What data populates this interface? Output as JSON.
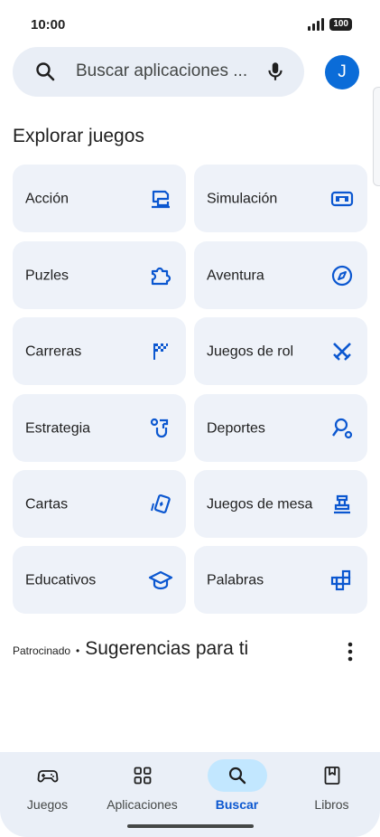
{
  "status_bar": {
    "time": "10:00",
    "battery": "100"
  },
  "search": {
    "placeholder": "Buscar aplicaciones ...",
    "icon": "search-icon",
    "mic_icon": "mic-icon"
  },
  "account": {
    "initial": "J",
    "color": "#0b6cd8"
  },
  "explore": {
    "title": "Explorar juegos",
    "categories": [
      {
        "label": "Acción",
        "icon": "action-game-icon"
      },
      {
        "label": "Simulación",
        "icon": "simulation-icon"
      },
      {
        "label": "Puzles",
        "icon": "puzzle-icon"
      },
      {
        "label": "Aventura",
        "icon": "compass-icon"
      },
      {
        "label": "Carreras",
        "icon": "checkered-flag-icon"
      },
      {
        "label": "Juegos de rol",
        "icon": "crossed-swords-icon"
      },
      {
        "label": "Estrategia",
        "icon": "strategy-icon"
      },
      {
        "label": "Deportes",
        "icon": "sports-icon"
      },
      {
        "label": "Cartas",
        "icon": "cards-icon"
      },
      {
        "label": "Juegos de mesa",
        "icon": "board-game-icon"
      },
      {
        "label": "Educativos",
        "icon": "graduation-cap-icon"
      },
      {
        "label": "Palabras",
        "icon": "word-tiles-icon"
      }
    ]
  },
  "suggestions": {
    "sponsored_label": "Patrocinado",
    "separator": "•",
    "title": "Sugerencias para ti"
  },
  "bottom_nav": {
    "items": [
      {
        "label": "Juegos",
        "icon": "gamepad-icon",
        "active": false
      },
      {
        "label": "Aplicaciones",
        "icon": "apps-grid-icon",
        "active": false
      },
      {
        "label": "Buscar",
        "icon": "search-icon",
        "active": true
      },
      {
        "label": "Libros",
        "icon": "bookmark-book-icon",
        "active": false
      }
    ]
  },
  "colors": {
    "accent": "#0b57d0",
    "tile_background": "#eef2f9",
    "active_pill": "#c2e7ff"
  }
}
